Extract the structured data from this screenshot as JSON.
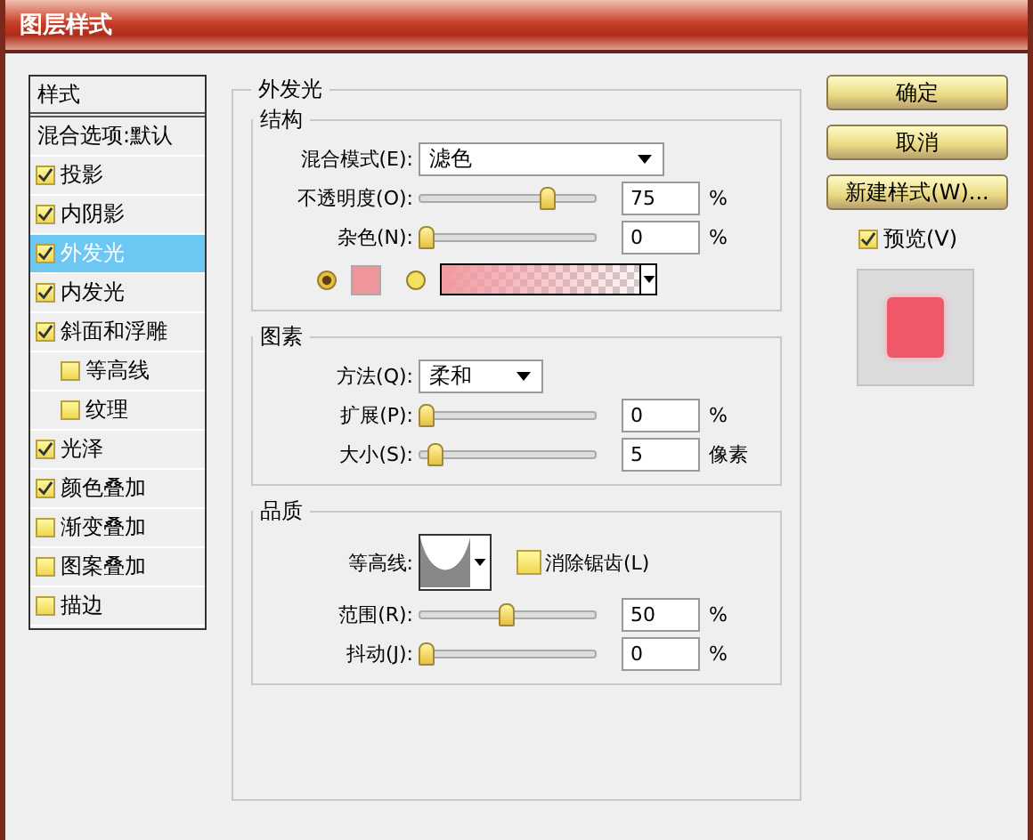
{
  "window": {
    "title": "图层样式"
  },
  "styles_panel": {
    "header": "样式",
    "blending_options": "混合选项:默认",
    "items": [
      {
        "label": "投影",
        "checked": true,
        "selected": false
      },
      {
        "label": "内阴影",
        "checked": true,
        "selected": false
      },
      {
        "label": "外发光",
        "checked": true,
        "selected": true
      },
      {
        "label": "内发光",
        "checked": true,
        "selected": false
      },
      {
        "label": "斜面和浮雕",
        "checked": true,
        "selected": false,
        "children": [
          {
            "label": "等高线",
            "checked": false,
            "selected": false
          },
          {
            "label": "纹理",
            "checked": false,
            "selected": false
          }
        ]
      },
      {
        "label": "光泽",
        "checked": true,
        "selected": false
      },
      {
        "label": "颜色叠加",
        "checked": true,
        "selected": false
      },
      {
        "label": "渐变叠加",
        "checked": false,
        "selected": false
      },
      {
        "label": "图案叠加",
        "checked": false,
        "selected": false
      },
      {
        "label": "描边",
        "checked": false,
        "selected": false
      }
    ]
  },
  "outer_glow": {
    "title": "外发光",
    "structure": {
      "title": "结构",
      "rows": [
        {
          "kind": "select",
          "label": "混合模式(E):",
          "value": "滤色"
        },
        {
          "kind": "slider",
          "label": "不透明度(O):",
          "level": 0.75,
          "value": "75",
          "unit": "%"
        },
        {
          "kind": "slider",
          "label": "杂色(N):",
          "level": 0,
          "value": "0",
          "unit": "%"
        }
      ],
      "glow_source": [
        {
          "kind": "color",
          "selected": true
        },
        {
          "kind": "gradient",
          "selected": false
        }
      ]
    },
    "elements": {
      "title": "图素",
      "rows": [
        {
          "kind": "select",
          "label": "方法(Q):",
          "value": "柔和"
        },
        {
          "kind": "slider",
          "label": "扩展(P):",
          "level": 0,
          "value": "0",
          "unit": "%"
        },
        {
          "kind": "slider",
          "label": "大小(S):",
          "level": 0.05,
          "value": "5",
          "unit": "像素"
        }
      ]
    },
    "quality": {
      "title": "品质",
      "contour_label": "等高线:",
      "anti_alias": {
        "label": "消除锯齿(L)",
        "checked": false
      },
      "rows": [
        {
          "label": "范围(R):",
          "level": 0.5,
          "value": "50",
          "unit": "%"
        },
        {
          "label": "抖动(J):",
          "level": 0,
          "value": "0",
          "unit": "%"
        }
      ]
    }
  },
  "buttons": [
    "确定",
    "取消",
    "新建样式(W)..."
  ],
  "preview": {
    "label": "预览(V)",
    "checked": true
  }
}
